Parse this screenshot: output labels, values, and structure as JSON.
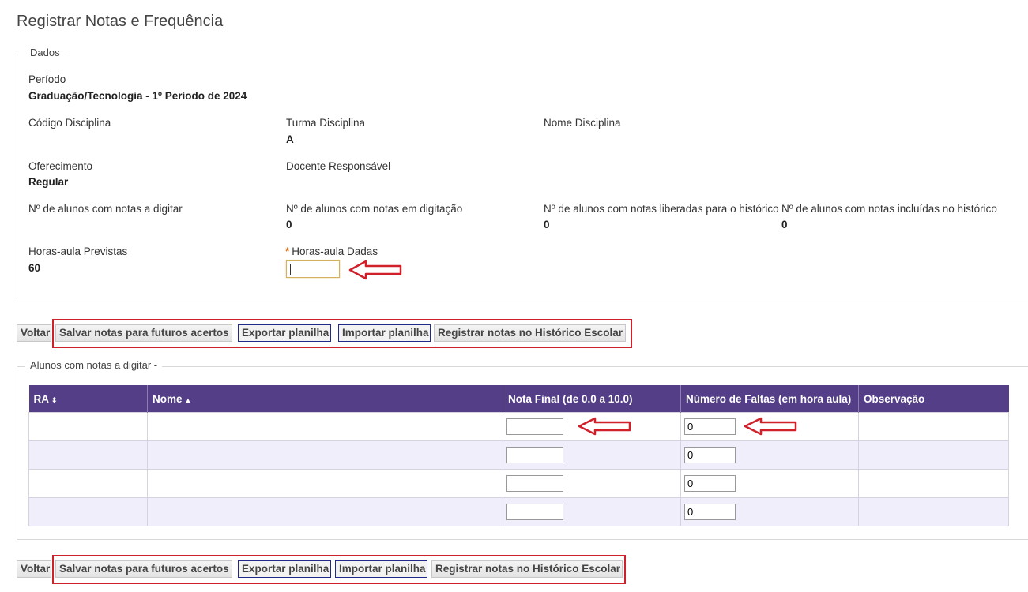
{
  "title": "Registrar Notas e Frequência",
  "dados": {
    "legend": "Dados",
    "periodo_label": "Período",
    "periodo_value": "Graduação/Tecnologia - 1º Período de 2024",
    "codigo_label": "Código Disciplina",
    "turma_label": "Turma Disciplina",
    "turma_value": "A",
    "nome_label": "Nome Disciplina",
    "oferecimento_label": "Oferecimento",
    "oferecimento_value": "Regular",
    "docente_label": "Docente Responsável",
    "a_digitar_label": "Nº de alunos com notas a digitar",
    "em_digitacao_label": "Nº de alunos com notas em digitação",
    "em_digitacao_value": "0",
    "liberadas_label": "Nº de alunos com notas liberadas para o histórico",
    "liberadas_value": "0",
    "incluidas_label": "Nº de alunos com notas incluídas no histórico",
    "incluidas_value": "0",
    "previstas_label": "Horas-aula Previstas",
    "previstas_value": "60",
    "dadas_label": "Horas-aula Dadas",
    "dadas_required": "*",
    "dadas_value": ""
  },
  "toolbar": {
    "voltar": "Voltar",
    "salvar": "Salvar notas para futuros acertos",
    "exportar": "Exportar planilha",
    "importar": "Importar planilha",
    "registrar": "Registrar notas no Histórico Escolar"
  },
  "alunos": {
    "legend": "Alunos com notas a digitar -",
    "columns": {
      "ra": "RA",
      "nome": "Nome",
      "nota": "Nota Final (de 0.0 a 10.0)",
      "faltas": "Número de Faltas (em hora aula)",
      "obs": "Observação"
    },
    "rows": [
      {
        "ra": "",
        "nome": "",
        "nota": "",
        "faltas": "0",
        "obs": ""
      },
      {
        "ra": "",
        "nome": "",
        "nota": "",
        "faltas": "0",
        "obs": ""
      },
      {
        "ra": "",
        "nome": "",
        "nota": "",
        "faltas": "0",
        "obs": ""
      },
      {
        "ra": "",
        "nome": "",
        "nota": "",
        "faltas": "0",
        "obs": ""
      }
    ]
  },
  "colors": {
    "header_bg": "#533e87",
    "highlight": "#d0202a",
    "alt_row": "#efeefa"
  }
}
